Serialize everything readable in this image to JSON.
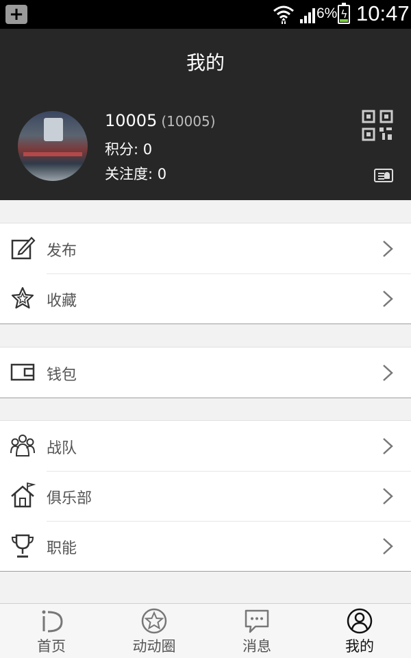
{
  "status_bar": {
    "notification_icon": "plus-icon",
    "battery_percent": "6%",
    "time": "10:47"
  },
  "header": {
    "title": "我的",
    "user_id": "10005",
    "user_id_sub": "(10005)",
    "points": "积分: 0",
    "follow": "关注度: 0"
  },
  "menu": {
    "groups": [
      {
        "items": [
          {
            "label": "发布",
            "icon": "edit-icon"
          },
          {
            "label": "收藏",
            "icon": "star-icon"
          }
        ]
      },
      {
        "items": [
          {
            "label": "钱包",
            "icon": "wallet-icon"
          }
        ]
      },
      {
        "items": [
          {
            "label": "战队",
            "icon": "team-icon"
          },
          {
            "label": "俱乐部",
            "icon": "house-flag-icon"
          },
          {
            "label": "职能",
            "icon": "trophy-icon"
          }
        ]
      }
    ]
  },
  "tabbar": {
    "tabs": [
      {
        "label": "首页",
        "icon": "home-d-icon"
      },
      {
        "label": "动动圈",
        "icon": "circle-star-icon"
      },
      {
        "label": "消息",
        "icon": "chat-icon"
      },
      {
        "label": "我的",
        "icon": "user-icon",
        "active": true
      }
    ]
  }
}
